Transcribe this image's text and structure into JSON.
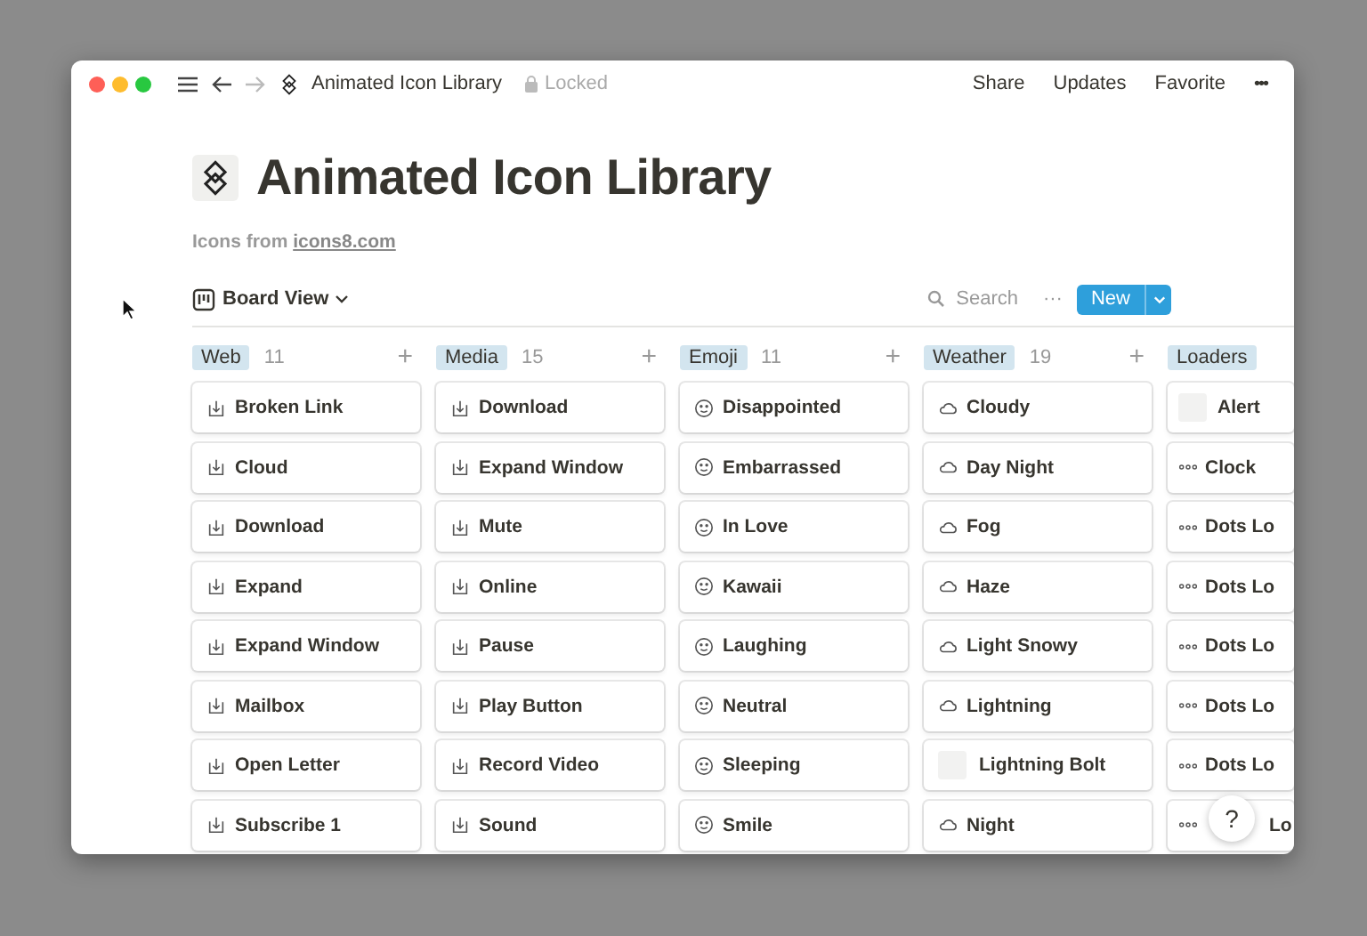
{
  "titlebar": {
    "breadcrumb": "Animated Icon Library",
    "lock_label": "Locked",
    "actions": [
      "Share",
      "Updates",
      "Favorite"
    ],
    "more": "•••"
  },
  "page": {
    "title": "Animated Icon Library",
    "subtitle": "Icons from ",
    "link": "icons8.com"
  },
  "toolbar": {
    "view": "Board View",
    "search": "Search",
    "more": "···",
    "new_button": "New"
  },
  "columns": [
    {
      "name": "Web",
      "count": "11",
      "add": "+",
      "cards": [
        {
          "text": "Broken Link"
        },
        {
          "text": "Cloud"
        },
        {
          "text": "Download"
        },
        {
          "text": "Expand"
        },
        {
          "text": "Expand Window"
        },
        {
          "text": "Mailbox"
        },
        {
          "text": "Open Letter"
        },
        {
          "text": "Subscribe 1"
        }
      ]
    },
    {
      "name": "Media",
      "count": "15",
      "add": "+",
      "cards": [
        {
          "text": "Download"
        },
        {
          "text": "Expand Window"
        },
        {
          "text": "Mute"
        },
        {
          "text": "Online"
        },
        {
          "text": "Pause"
        },
        {
          "text": "Play Button"
        },
        {
          "text": "Record Video"
        },
        {
          "text": "Sound"
        }
      ]
    },
    {
      "name": "Emoji",
      "count": "11",
      "add": "+",
      "cards": [
        {
          "text": "Disappointed"
        },
        {
          "text": "Embarrassed"
        },
        {
          "text": "In Love"
        },
        {
          "text": "Kawaii"
        },
        {
          "text": "Laughing"
        },
        {
          "text": "Neutral"
        },
        {
          "text": "Sleeping"
        },
        {
          "text": "Smile"
        }
      ]
    },
    {
      "name": "Weather",
      "count": "19",
      "add": "+",
      "cards": [
        {
          "text": "Cloudy"
        },
        {
          "text": "Day Night"
        },
        {
          "text": "Fog"
        },
        {
          "text": "Haze"
        },
        {
          "text": "Light Snowy"
        },
        {
          "text": "Lightning"
        },
        {
          "text": "Lightning Bolt",
          "placeholder_icon": true
        },
        {
          "text": "Night"
        }
      ]
    },
    {
      "name": "Loaders",
      "cards": [
        {
          "text": "Alert",
          "placeholder_icon": true
        },
        {
          "text": "Clock"
        },
        {
          "text": "Dots Lo"
        },
        {
          "text": "Dots Lo"
        },
        {
          "text": "Dots Lo"
        },
        {
          "text": "Dots Lo"
        },
        {
          "text": "Dots Lo"
        },
        {
          "text": "Lo",
          "covered": true
        }
      ]
    }
  ],
  "help": "?"
}
